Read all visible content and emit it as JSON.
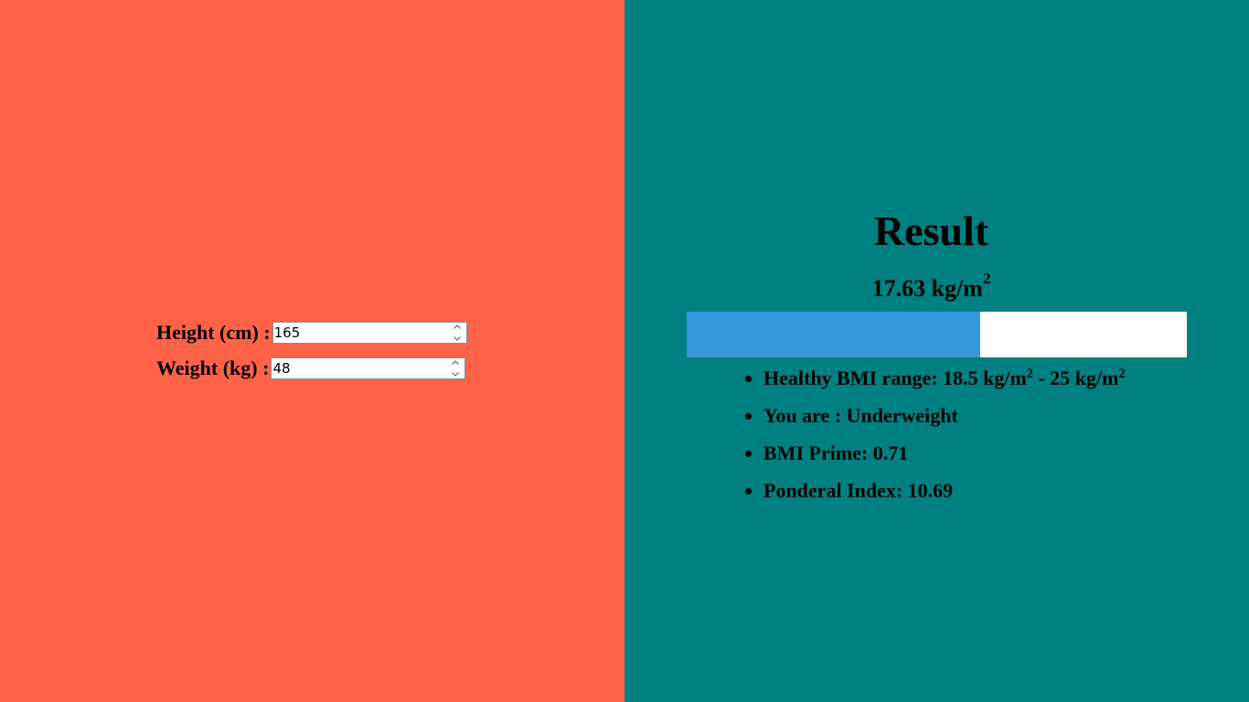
{
  "form": {
    "height_label": "Height (cm) :",
    "height_value": "165",
    "weight_label": "Weight (kg) :",
    "weight_value": "48"
  },
  "result": {
    "title": "Result",
    "bmi_value": "17.63 kg/m",
    "bmi_unit_exp": "2",
    "bar_fill_fraction": 0.587,
    "bar_fill_color": "#3498db",
    "bar_track_color": "#ffffff",
    "info": {
      "range_prefix": "Healthy BMI range: 18.5 kg/m",
      "range_exp1": "2",
      "range_mid": " - 25 kg/m",
      "range_exp2": "2",
      "category": "You are : Underweight",
      "prime": "BMI Prime: 0.71",
      "ponderal": "Ponderal Index: 10.69"
    }
  },
  "colors": {
    "left_bg": "#ff6347",
    "right_bg": "#008080"
  },
  "icons": {
    "spinner": "spinner-up-down-icon"
  }
}
